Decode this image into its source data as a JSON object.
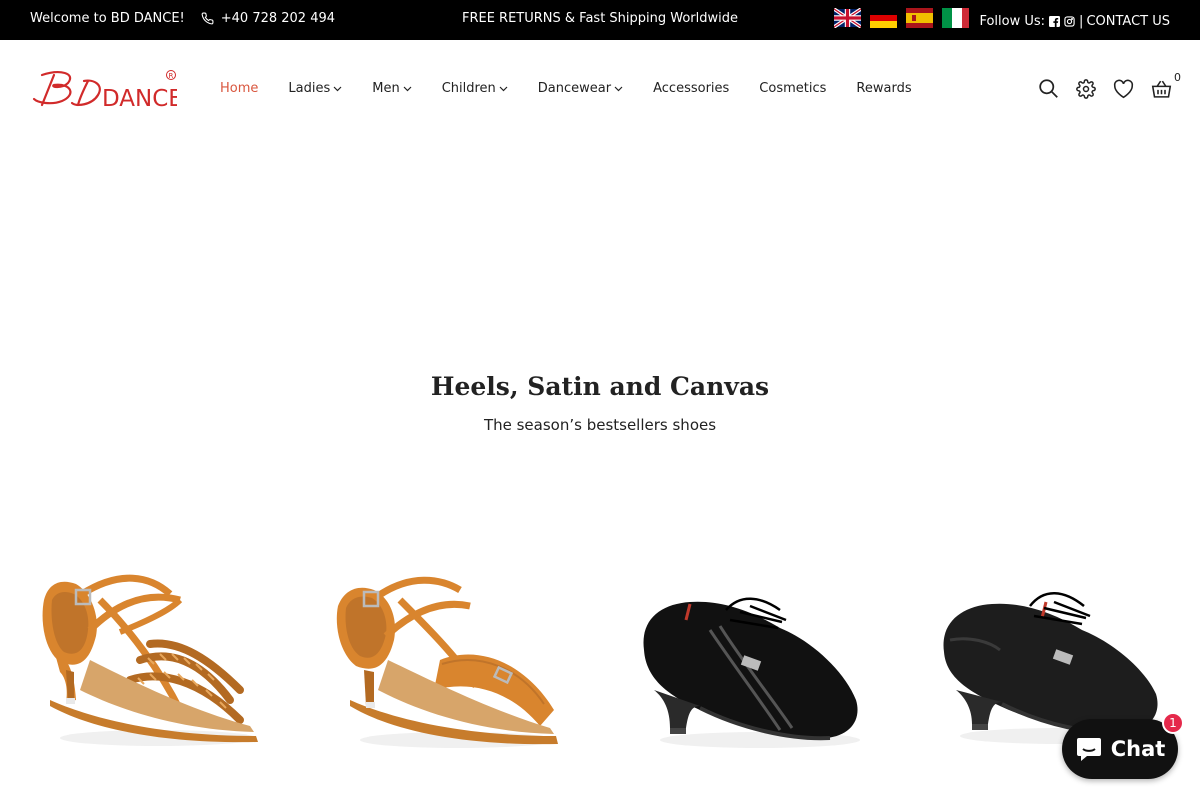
{
  "topbar": {
    "welcome": "Welcome to BD DANCE!",
    "phone": "+40 728 202 494",
    "promo": "FREE RETURNS & Fast Shipping Worldwide",
    "follow_label": "Follow Us:",
    "separator": "|",
    "contact": "CONTACT US",
    "languages": [
      "English",
      "Deutsch",
      "Español",
      "Italiano"
    ]
  },
  "logo": {
    "text": "DANCE",
    "mark": "BD",
    "registered": "®"
  },
  "nav": {
    "items": [
      {
        "label": "Home",
        "active": true,
        "dropdown": false
      },
      {
        "label": "Ladies",
        "active": false,
        "dropdown": true
      },
      {
        "label": "Men",
        "active": false,
        "dropdown": true
      },
      {
        "label": "Children",
        "active": false,
        "dropdown": true
      },
      {
        "label": "Dancewear",
        "active": false,
        "dropdown": true
      },
      {
        "label": "Accessories",
        "active": false,
        "dropdown": false
      },
      {
        "label": "Cosmetics",
        "active": false,
        "dropdown": false
      },
      {
        "label": "Rewards",
        "active": false,
        "dropdown": false
      }
    ]
  },
  "header_icons": {
    "icons": [
      "search-icon",
      "gear-icon",
      "heart-icon",
      "cart-icon"
    ],
    "cart_count": "0"
  },
  "hero": {
    "title": "Heels, Satin and Canvas",
    "subtitle": "The season’s bestsellers shoes"
  },
  "products": [
    {
      "kind": "tan satin latin sandal"
    },
    {
      "kind": "tan satin latin sandal"
    },
    {
      "kind": "black canvas practice shoe"
    },
    {
      "kind": "black leather practice shoe"
    }
  ],
  "chat": {
    "label": "Chat",
    "badge": "1"
  },
  "colors": {
    "accent": "#d9573f",
    "topbar_bg": "#000000",
    "chat_bg": "#111111",
    "badge": "#e5294b",
    "satin": "#d9852e"
  }
}
